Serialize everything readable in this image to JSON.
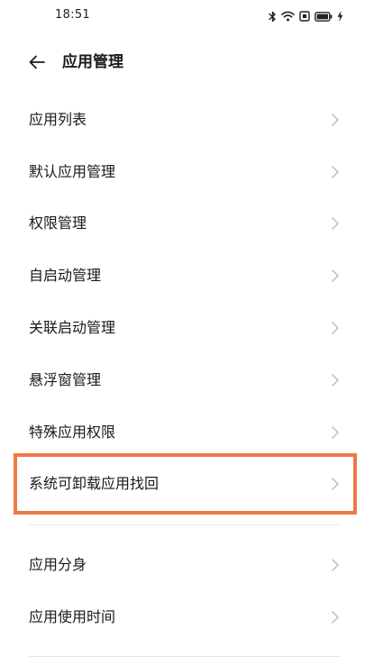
{
  "status_bar": {
    "time": "18:51"
  },
  "header": {
    "title": "应用管理",
    "back_icon": "arrow-left-icon"
  },
  "menu": {
    "items": [
      {
        "label": "应用列表"
      },
      {
        "label": "默认应用管理"
      },
      {
        "label": "权限管理"
      },
      {
        "label": "自启动管理"
      },
      {
        "label": "关联启动管理"
      },
      {
        "label": "悬浮窗管理"
      },
      {
        "label": "特殊应用权限"
      },
      {
        "label": "系统可卸载应用找回"
      },
      {
        "label": "应用分身"
      },
      {
        "label": "应用使用时间"
      }
    ]
  },
  "colors": {
    "highlight": "#ee7a45",
    "chevron": "#b9b9b9",
    "divider": "#e8e8e8"
  }
}
